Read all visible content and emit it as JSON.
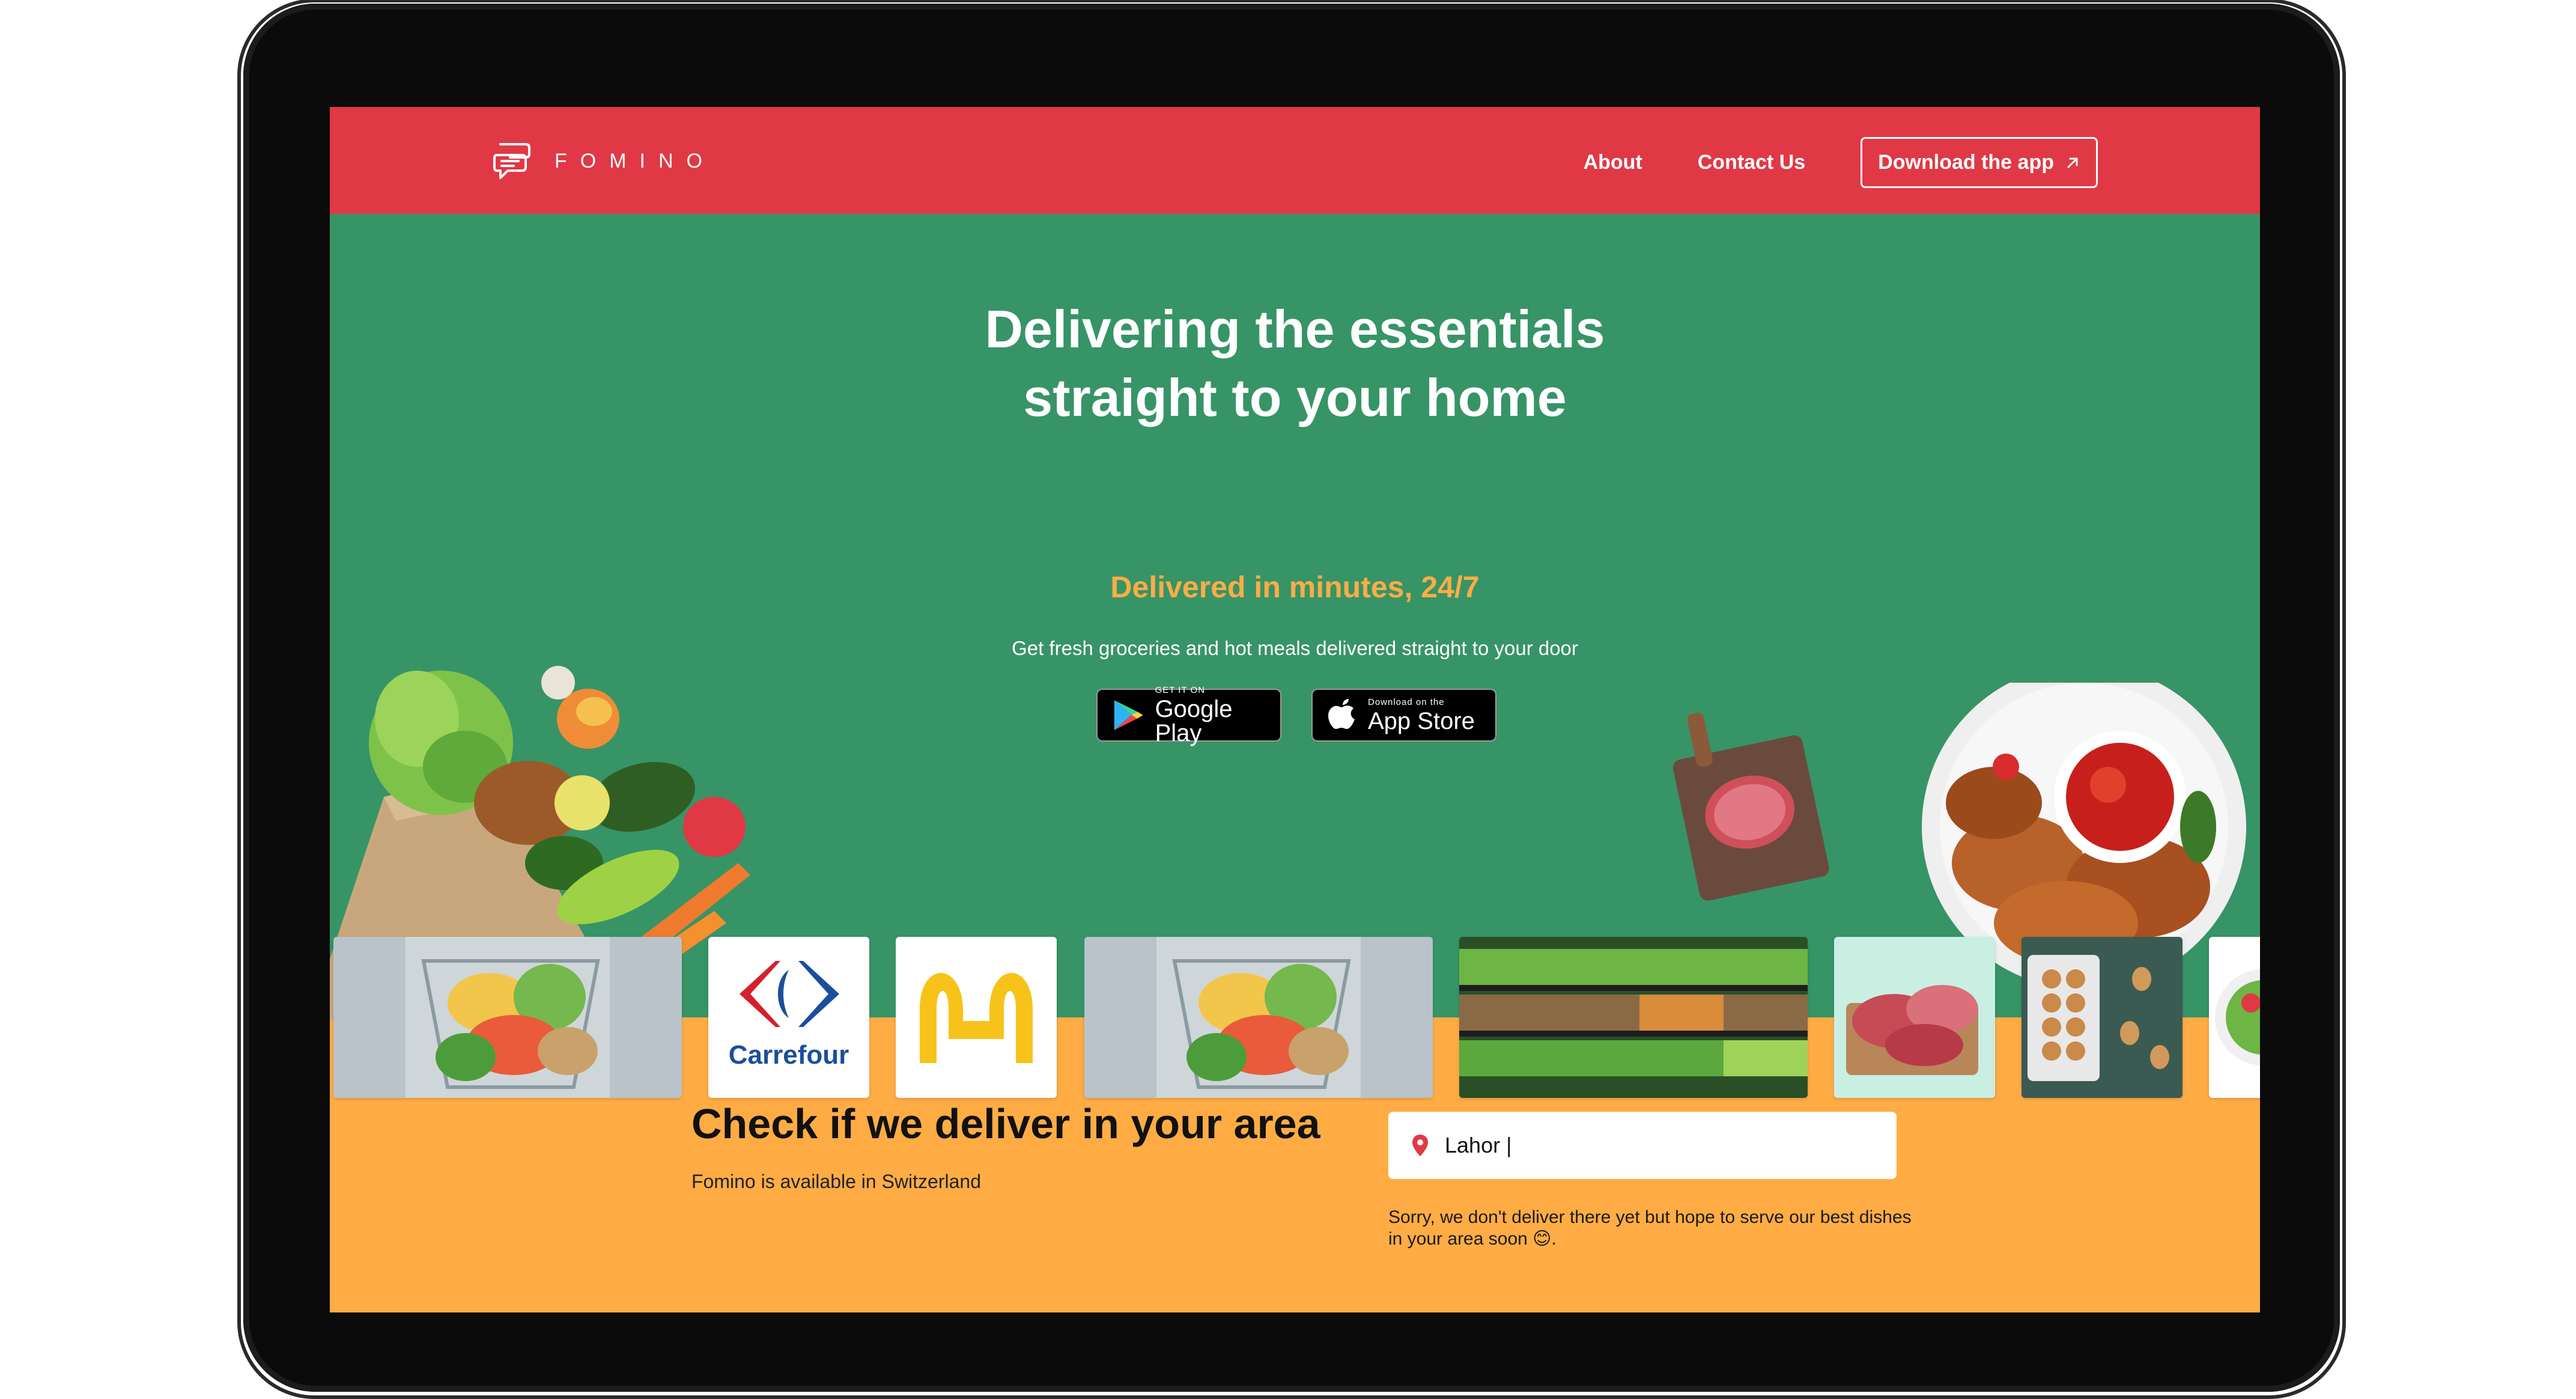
{
  "brand": {
    "name": "FOMINO",
    "accent_red": "#e13845",
    "hero_green": "#379467",
    "accent_orange": "#ffac45"
  },
  "nav": {
    "about": "About",
    "contact": "Contact Us",
    "download": "Download the app"
  },
  "hero": {
    "title_line1": "Delivering the essentials",
    "title_line2": "straight to your home",
    "subtitle": "Delivered in minutes, 24/7",
    "description": "Get fresh groceries and hot meals delivered straight to your door"
  },
  "stores": {
    "google_small": "GET IT ON",
    "google_big": "Google Play",
    "apple_small": "Download on the",
    "apple_big": "App Store"
  },
  "tiles": {
    "carrefour": "Carrefour"
  },
  "area": {
    "title": "Check if we deliver in your area",
    "subtitle": "Fomino is available in Switzerland",
    "input_value": "Lahor |",
    "message": "Sorry, we don't deliver there yet but hope to serve our best dishes in your area soon 😊."
  }
}
